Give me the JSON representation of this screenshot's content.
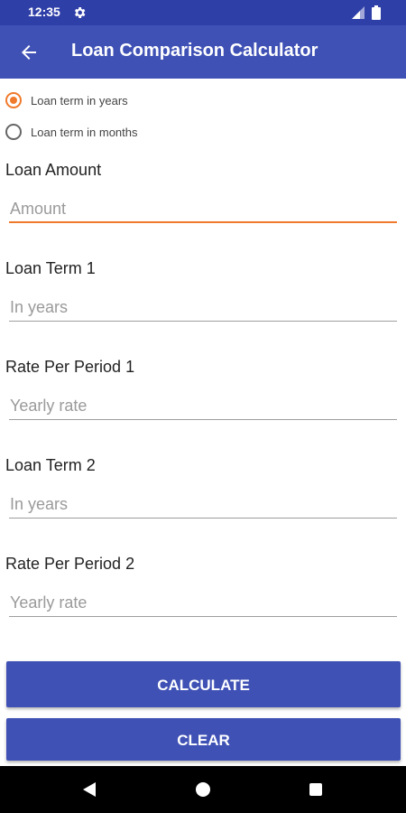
{
  "status_bar": {
    "time": "12:35",
    "icons": [
      "gear-icon",
      "signal-icon",
      "battery-icon"
    ]
  },
  "app_bar": {
    "title": "Loan Comparison Calculator",
    "back_icon": "arrow-back-icon"
  },
  "term_mode": {
    "selected": "years",
    "options": [
      {
        "label": "Loan term in years",
        "checked": true
      },
      {
        "label": "Loan term in months",
        "checked": false
      }
    ]
  },
  "fields": {
    "loan_amount": {
      "label": "Loan Amount",
      "value": "",
      "placeholder": "Amount"
    },
    "loan_term_1": {
      "label": "Loan Term 1",
      "value": "",
      "placeholder": "In years"
    },
    "rate_1": {
      "label": "Rate Per Period 1",
      "value": "",
      "placeholder": "Yearly rate"
    },
    "loan_term_2": {
      "label": "Loan Term 2",
      "value": "",
      "placeholder": "In years"
    },
    "rate_2": {
      "label": "Rate Per Period 2",
      "value": "",
      "placeholder": "Yearly rate"
    }
  },
  "buttons": {
    "calculate": "CALCULATE",
    "clear": "CLEAR"
  },
  "colors": {
    "primary": "#3f51b5",
    "primary_dark": "#2f3fa8",
    "accent": "#f07a2c"
  },
  "nav_bar": {
    "icons": [
      "back-triangle-icon",
      "home-circle-icon",
      "recents-square-icon"
    ]
  }
}
